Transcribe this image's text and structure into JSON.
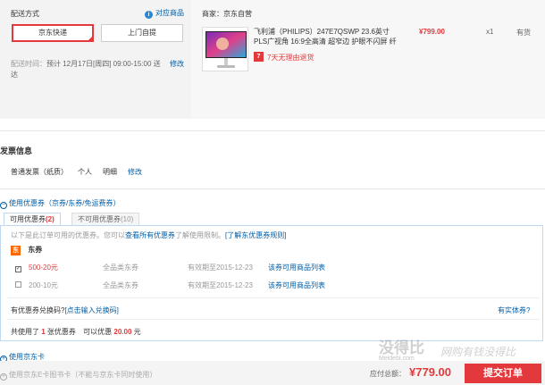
{
  "shipping": {
    "title": "配送方式",
    "info_link": "对应商品",
    "options": [
      "京东快递",
      "上门自提"
    ],
    "time_label": "配送时间：",
    "time_value": "预计 12月17日[周四] 09:00-15:00 送达",
    "modify": "修改"
  },
  "seller": {
    "label": "商家：京东自营"
  },
  "product": {
    "title": "飞利浦（PHILIPS）247E7QSWP 23.6英寸PLS广视角 16:9全高清 超窄边 护眼不闪屏 纤",
    "price": "¥799.00",
    "qty": "x1",
    "stock": "有货",
    "return_badge": "7",
    "return_text": "7天无理由退货"
  },
  "invoice": {
    "heading": "发票信息",
    "type": "普通发票（纸质）",
    "person": "个人",
    "detail": "明细",
    "modify": "修改"
  },
  "coupon": {
    "toggle_label": "使用优惠券（京券/东券/免运费券）",
    "tab_usable": "可用优惠券",
    "tab_usable_count": "(2)",
    "tab_unusable": "不可用优惠券",
    "tab_unusable_count": "(10)",
    "notice_prefix": "以下是此订单可用的优惠券。您可以",
    "notice_link": "查看所有优惠券",
    "notice_mid": "了解使用限制。",
    "notice_link2": "[了解东优惠券规则]",
    "group_tag": "东",
    "group_name": "东券",
    "items": [
      {
        "checked": true,
        "amount": "500-20元",
        "scope": "全品类东券",
        "expiry": "有效期至2015-12-23",
        "link": "该券可用商品列表"
      },
      {
        "checked": false,
        "amount": "200-10元",
        "scope": "全品类东券",
        "expiry": "有效期至2015-12-23",
        "link": "该券可用商品列表"
      }
    ],
    "redeem_prefix": "有优惠券兑换码?",
    "redeem_link": "[点击输入兑换码]",
    "physical_link": "有实体券?",
    "summary_prefix": "共使用了",
    "summary_count": "1",
    "summary_mid": "张优惠券",
    "summary_save": "可以优惠",
    "summary_amount": "20.00",
    "summary_unit": "元"
  },
  "jdcard": {
    "toggle_label": "使用京东卡",
    "ecard_label": "使用京东E卡图书卡（不能与京东卡同时使用）"
  },
  "footer": {
    "total_label": "应付总额：",
    "total_value": "¥779.00",
    "submit": "提交订单"
  },
  "watermark": {
    "logo": "没得比",
    "slogan": "网购有钱没得比",
    "url": "Meidebi.com"
  }
}
